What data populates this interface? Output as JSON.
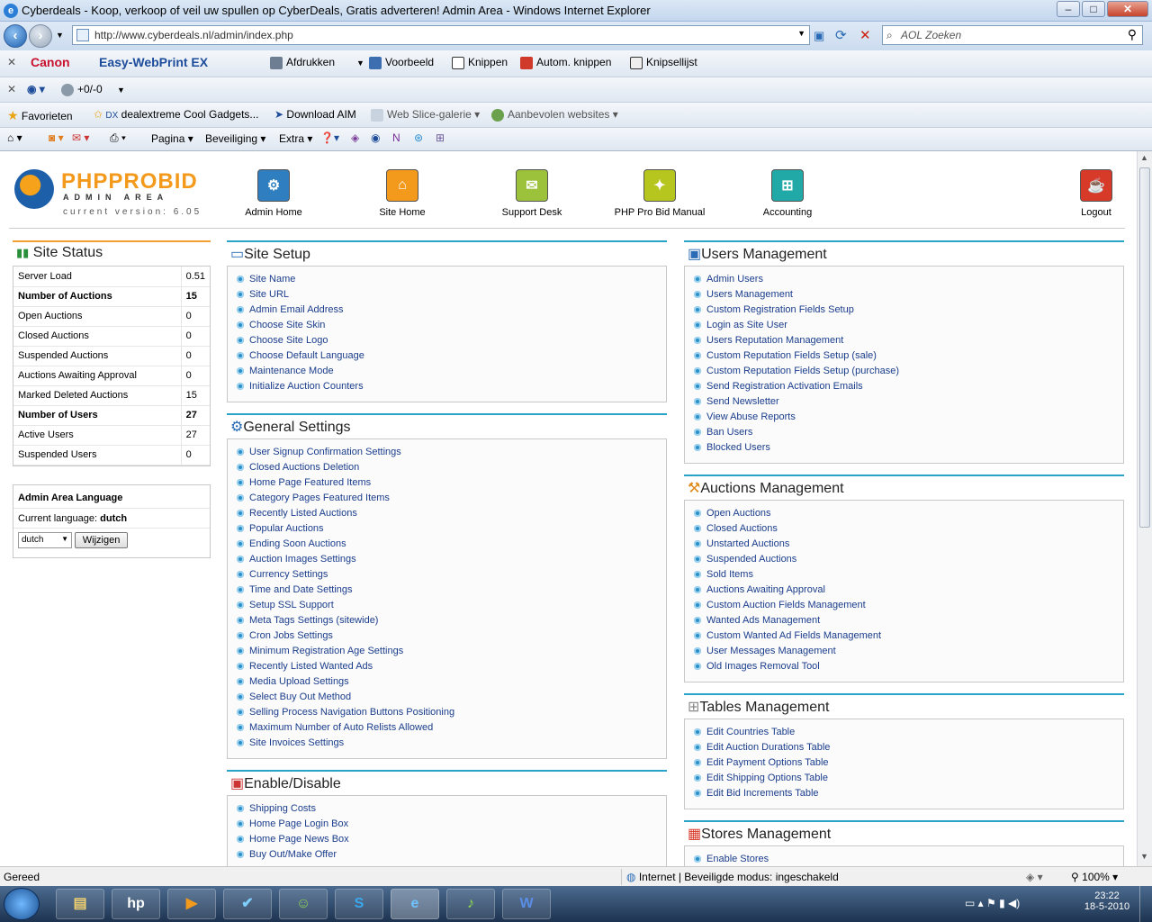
{
  "window": {
    "title": "Cyberdeals - Koop, verkoop of veil uw spullen op CyberDeals, Gratis adverteren! Admin Area - Windows Internet Explorer"
  },
  "address": {
    "url": "http://www.cyberdeals.nl/admin/index.php",
    "search_placeholder": "AOL Zoeken"
  },
  "toolbar1": {
    "canon": "Canon",
    "ewp": "Easy-WebPrint EX",
    "print": "Afdrukken",
    "preview": "Voorbeeld",
    "clip": "Knippen",
    "autoclip": "Autom. knippen",
    "cliplist": "Knipsellijst"
  },
  "toolbar2": {
    "counter": "+0/-0"
  },
  "favorites": {
    "label": "Favorieten",
    "items": [
      "dealextreme Cool Gadgets...",
      "Download AIM",
      "Web Slice-galerie",
      "Aanbevolen websites"
    ]
  },
  "commandbar": {
    "page": "Pagina",
    "safety": "Beveiliging",
    "tools": "Extra"
  },
  "header": {
    "logo_main": "PHPPROBID",
    "logo_sub": "ADMIN AREA",
    "version": "current version: 6.05",
    "nav": [
      "Admin Home",
      "Site Home",
      "Support Desk",
      "PHP Pro Bid Manual",
      "Accounting"
    ],
    "logout": "Logout"
  },
  "site_status": {
    "title": "Site Status",
    "rows": [
      {
        "label": "Server Load",
        "value": "0.51"
      },
      {
        "label": "Number of Auctions",
        "value": "15"
      },
      {
        "label": "Open Auctions",
        "value": "0"
      },
      {
        "label": "Closed Auctions",
        "value": "0"
      },
      {
        "label": "Suspended Auctions",
        "value": "0"
      },
      {
        "label": "Auctions Awaiting Approval",
        "value": "0"
      },
      {
        "label": "Marked Deleted Auctions",
        "value": "15"
      },
      {
        "label": "Number of Users",
        "value": "27"
      },
      {
        "label": "Active Users",
        "value": "27"
      },
      {
        "label": "Suspended Users",
        "value": "0"
      }
    ]
  },
  "language": {
    "title": "Admin Area Language",
    "current_label": "Current language:",
    "current": "dutch",
    "select": "dutch",
    "button": "Wijzigen"
  },
  "site_setup": {
    "title": "Site Setup",
    "items": [
      "Site Name",
      "Site URL",
      "Admin Email Address",
      "Choose Site Skin",
      "Choose Site Logo",
      "Choose Default Language",
      "Maintenance Mode",
      "Initialize Auction Counters"
    ]
  },
  "general_settings": {
    "title": "General Settings",
    "items": [
      "User Signup Confirmation Settings",
      "Closed Auctions Deletion",
      "Home Page Featured Items",
      "Category Pages Featured Items",
      "Recently Listed Auctions",
      "Popular Auctions",
      "Ending Soon Auctions",
      "Auction Images Settings",
      "Currency Settings",
      "Time and Date Settings",
      "Setup SSL Support",
      "Meta Tags Settings (sitewide)",
      "Cron Jobs Settings",
      "Minimum Registration Age Settings",
      "Recently Listed Wanted Ads",
      "Media Upload Settings",
      "Select Buy Out Method",
      "Selling Process Navigation Buttons Positioning",
      "Maximum Number of Auto Relists Allowed",
      "Site Invoices Settings"
    ]
  },
  "enable_disable": {
    "title": "Enable/Disable",
    "items": [
      "Shipping Costs",
      "Home Page Login Box",
      "Home Page News Box",
      "Buy Out/Make Offer"
    ]
  },
  "users_management": {
    "title": "Users Management",
    "items": [
      "Admin Users",
      "Users Management",
      "Custom Registration Fields Setup",
      "Login as Site User",
      "Users Reputation Management",
      "Custom Reputation Fields Setup (sale)",
      "Custom Reputation Fields Setup (purchase)",
      "Send Registration Activation Emails",
      "Send Newsletter",
      "View Abuse Reports",
      "Ban Users",
      "Blocked Users"
    ]
  },
  "auctions_management": {
    "title": "Auctions Management",
    "items": [
      "Open Auctions",
      "Closed Auctions",
      "Unstarted Auctions",
      "Suspended Auctions",
      "Sold Items",
      "Auctions Awaiting Approval",
      "Custom Auction Fields Management",
      "Wanted Ads Management",
      "Custom Wanted Ad Fields Management",
      "User Messages Management",
      "Old Images Removal Tool"
    ]
  },
  "tables_management": {
    "title": "Tables Management",
    "items": [
      "Edit Countries Table",
      "Edit Auction Durations Table",
      "Edit Payment Options Table",
      "Edit Shipping Options Table",
      "Edit Bid Increments Table"
    ]
  },
  "stores_management": {
    "title": "Stores Management",
    "items": [
      "Enable Stores"
    ]
  },
  "statusbar": {
    "left": "Gereed",
    "zone": "Internet | Beveiligde modus: ingeschakeld",
    "zoom": "100%"
  },
  "taskbar": {
    "time": "23:22",
    "date": "18-5-2010"
  }
}
